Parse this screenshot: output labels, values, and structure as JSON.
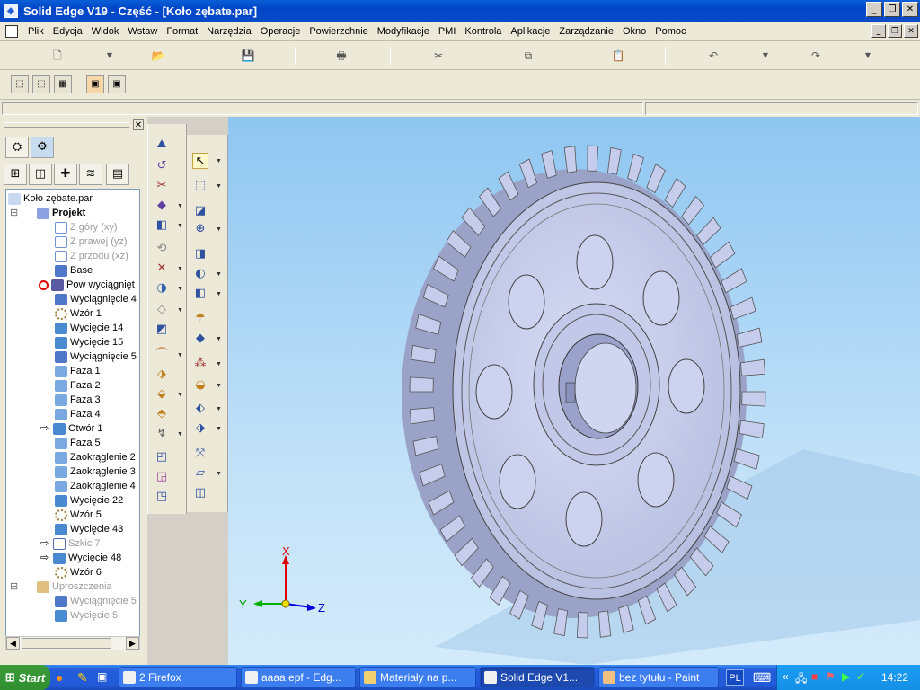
{
  "window": {
    "title": "Solid Edge V19 - Część - [Koło zębate.par]",
    "app_icon": "solid-edge-icon"
  },
  "menu": {
    "items": [
      "Plik",
      "Edycja",
      "Widok",
      "Wstaw",
      "Format",
      "Narzędzia",
      "Operacje",
      "Powierzchnie",
      "Modyfikacje",
      "PMI",
      "Kontrola",
      "Aplikacje",
      "Zarządzanie",
      "Okno",
      "Pomoc"
    ]
  },
  "toolbar": {
    "icons": [
      "new-icon",
      "open-icon",
      "save-icon",
      "print-icon",
      "cut-icon",
      "copy-icon",
      "paste-icon",
      "undo-icon",
      "redo-icon"
    ]
  },
  "tree": {
    "root": "Koło zębate.par",
    "project": "Projekt",
    "items": [
      {
        "label": "Z góry (xy)",
        "state": "dim"
      },
      {
        "label": "Z prawej (yz)",
        "state": "dim"
      },
      {
        "label": "Z przodu (xz)",
        "state": "dim"
      },
      {
        "label": "Base",
        "state": "normal"
      },
      {
        "label": "Pow wyciągnięt",
        "state": "error"
      },
      {
        "label": "Wyciągnięcie 4",
        "state": "normal"
      },
      {
        "label": "Wzór 1",
        "state": "normal"
      },
      {
        "label": "Wycięcie 14",
        "state": "normal"
      },
      {
        "label": "Wycięcie 15",
        "state": "normal"
      },
      {
        "label": "Wyciągnięcie 5",
        "state": "normal"
      },
      {
        "label": "Faza 1",
        "state": "normal"
      },
      {
        "label": "Faza 2",
        "state": "normal"
      },
      {
        "label": "Faza 3",
        "state": "normal"
      },
      {
        "label": "Faza 4",
        "state": "normal"
      },
      {
        "label": "Otwór 1",
        "state": "linked"
      },
      {
        "label": "Faza 5",
        "state": "normal"
      },
      {
        "label": "Zaokrąglenie 2",
        "state": "normal"
      },
      {
        "label": "Zaokrąglenie 3",
        "state": "normal"
      },
      {
        "label": "Zaokrąglenie 4",
        "state": "normal"
      },
      {
        "label": "Wycięcie 22",
        "state": "normal"
      },
      {
        "label": "Wzór 5",
        "state": "normal"
      },
      {
        "label": "Wycięcie 43",
        "state": "normal"
      },
      {
        "label": "Szkic 7",
        "state": "dim-linked"
      },
      {
        "label": "Wycięcie 48",
        "state": "linked"
      },
      {
        "label": "Wzór 6",
        "state": "normal"
      }
    ],
    "simplify": "Uproszczenia",
    "simplify_items": [
      "Wyciągnięcie 5",
      "Wycięcie 5"
    ]
  },
  "viewport": {
    "axis_x": "X",
    "axis_y": "Y",
    "axis_z": "Z",
    "colors": {
      "gear": "#c9d0ec",
      "background": "#a9d4f5"
    }
  },
  "taskbar": {
    "start": "Start",
    "buttons": [
      {
        "label": "2 Firefox",
        "icon": "firefox-icon"
      },
      {
        "label": "aaaa.epf - Edg...",
        "icon": "document-icon"
      },
      {
        "label": "Materiały na p...",
        "icon": "folder-icon"
      },
      {
        "label": "Solid Edge V1...",
        "icon": "solid-edge-icon",
        "active": true
      },
      {
        "label": "bez tytułu - Paint",
        "icon": "paint-icon"
      }
    ],
    "language": "PL",
    "clock": "14:22"
  }
}
